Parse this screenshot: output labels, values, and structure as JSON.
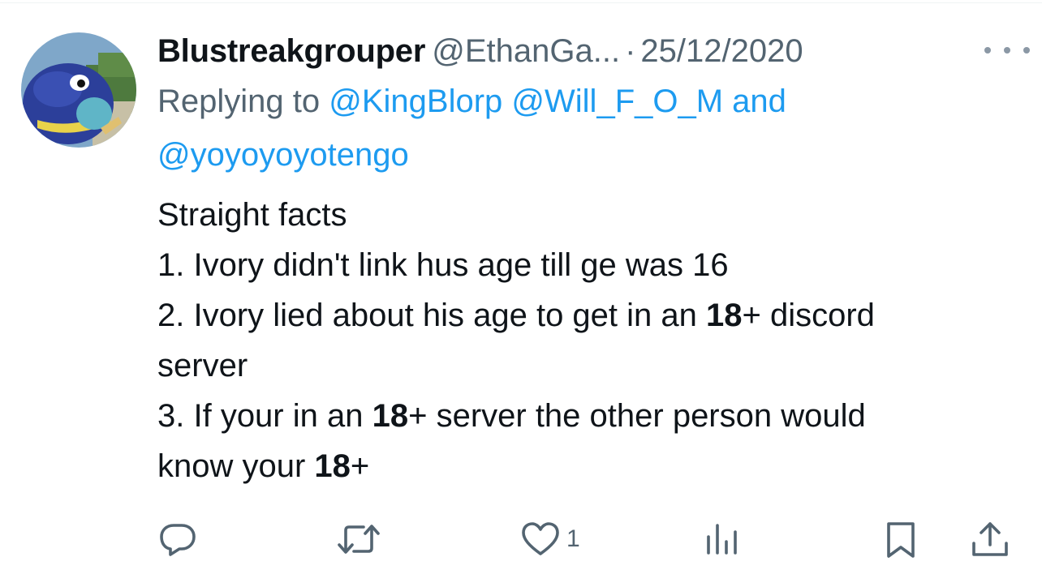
{
  "tweet": {
    "display_name": "Blustreakgrouper",
    "handle": "@EthanGa...",
    "separator": "·",
    "date": "25/12/2020",
    "more_icon": "more-horizontal-icon",
    "reply_prefix": "Replying to",
    "mentions": [
      "@KingBlorp",
      "@Will_F_O_M",
      "and",
      "@yoyoyoyotengo"
    ],
    "body": {
      "line1": "Straight facts",
      "line2": "1. Ivory didn't link hus age till ge was 16",
      "line3_a": "2. Ivory lied about his age to get in an ",
      "line3_b": "18",
      "line3_c": "+ discord",
      "line4": "server",
      "line5_a": "3. If your in an ",
      "line5_b": "18",
      "line5_c": "+ server the other person would",
      "line6_a": "know your ",
      "line6_b": "18",
      "line6_c": "+"
    }
  },
  "actions": {
    "reply": {
      "icon": "reply-icon"
    },
    "retweet": {
      "icon": "retweet-icon"
    },
    "like": {
      "icon": "heart-icon",
      "count": "1"
    },
    "views": {
      "icon": "views-chart-icon"
    },
    "bookmark": {
      "icon": "bookmark-icon"
    },
    "share": {
      "icon": "share-icon"
    }
  },
  "colors": {
    "text": "#0f1419",
    "secondary": "#536471",
    "link": "#1d9bf0",
    "icon": "#536471"
  }
}
